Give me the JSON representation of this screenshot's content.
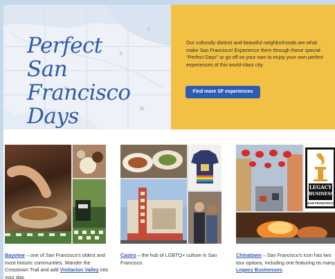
{
  "hero": {
    "title_lines": [
      "Perfect",
      "San Francisco",
      "Days"
    ],
    "description": "Our culturally distinct and beautiful neighborhoods are what make San Francisco! Experience them through these special \"Perfect Days\" or go off on your own to enjoy your own perfect experiences of this world-class city.",
    "button_label": "Find more SF experiences"
  },
  "cards": [
    {
      "name": "Bayview",
      "text": " – one of San Francisco's oldest and most historic communities. Wander the Crosstown Trail and add ",
      "link2": "Visitacion Valley",
      "text2": " into your day."
    },
    {
      "name": "Castro",
      "text": " – the hub of LGBTQ+ culture in San Francisco."
    },
    {
      "name": "Chinatown",
      "text": " – San Francisco's icon has two tour options, including one featuring its many ",
      "link2": "Legacy Businesses",
      "text2": "."
    }
  ],
  "badge": {
    "line1": "LEGACY",
    "line2": "BUSINESS",
    "line3": "SAN FRANCISCO"
  },
  "colors": {
    "accent_blue": "#2f5bb3",
    "panel_yellow": "#f2c144",
    "map_bg": "#eef1f7"
  }
}
